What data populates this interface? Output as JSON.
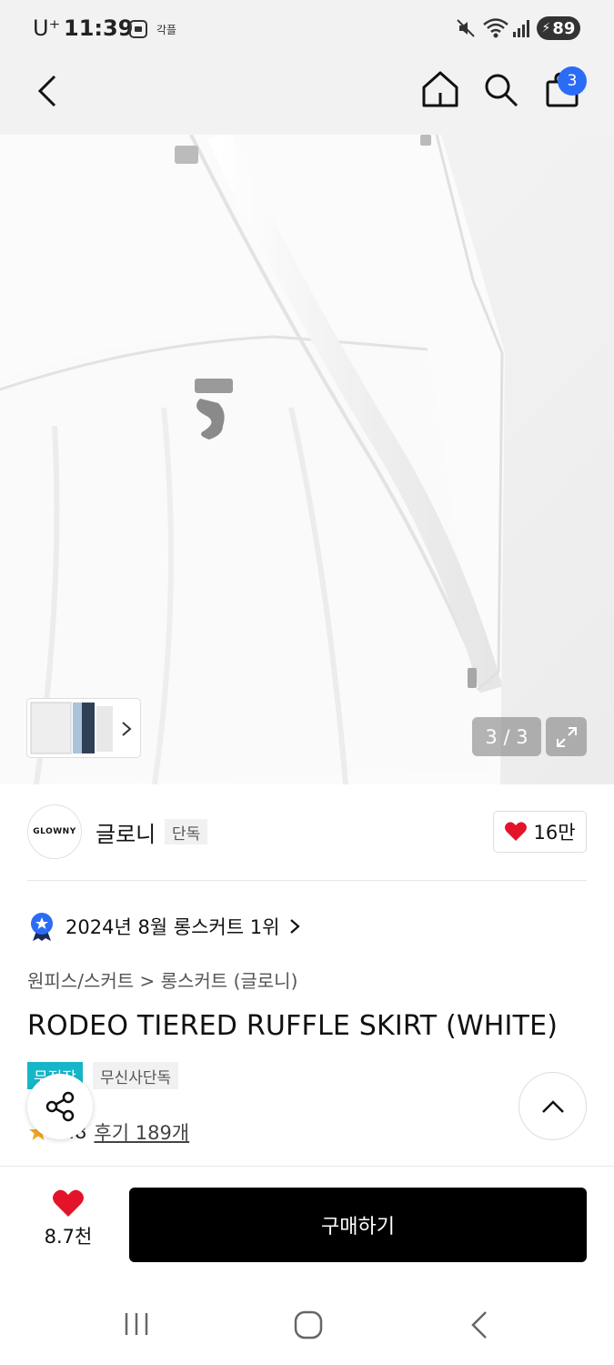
{
  "status_bar": {
    "carrier": "U⁺",
    "time": "11:39",
    "indicator_text": "각플",
    "battery": "89"
  },
  "header": {
    "cart_count": "3"
  },
  "gallery": {
    "counter": "3 / 3"
  },
  "brand": {
    "logo_text": "GLOWNY",
    "name": "글로니",
    "tag": "단독",
    "likes": "16만"
  },
  "ranking": {
    "text": "2024년 8월 롱스커트 1위"
  },
  "breadcrumb": {
    "text": "원피스/스커트 > 롱스커트 (글로니)"
  },
  "product": {
    "title": "RODEO TIERED RUFFLE SKIRT (WHITE)",
    "tags": [
      "무적장",
      "무신사단독"
    ],
    "rating_partial": "4.8",
    "reviews": "후기 189개"
  },
  "bottom_bar": {
    "wish_count": "8.7천",
    "buy_label": "구매하기"
  },
  "colors": {
    "accent_blue": "#2b6cf6",
    "heart_red": "#e3142a",
    "tag_teal": "#16b6c9",
    "buy_black": "#000000"
  },
  "icons": [
    "back-arrow-icon",
    "home-icon",
    "search-icon",
    "shopping-bag-icon",
    "expand-icon",
    "chevron-right-icon",
    "heart-icon",
    "ranking-badge-icon",
    "share-icon",
    "chevron-up-icon",
    "star-icon",
    "recents-icon",
    "home-circle-icon",
    "back-icon",
    "mute-icon",
    "wifi-icon",
    "signal-icon"
  ]
}
